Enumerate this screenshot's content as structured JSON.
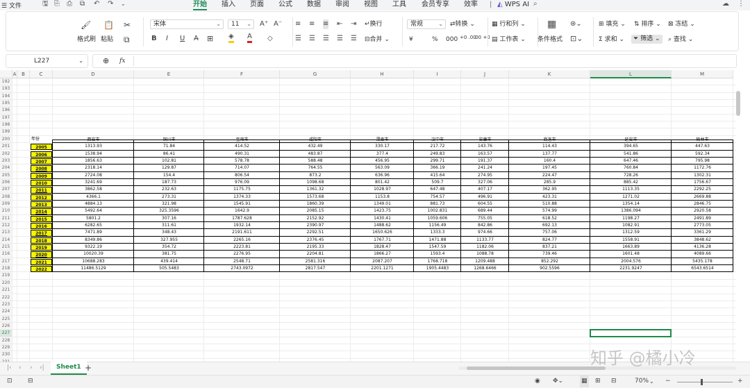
{
  "menubar": {
    "file": "文件",
    "tabs": [
      "开始",
      "插入",
      "页面",
      "公式",
      "数据",
      "审阅",
      "视图",
      "工具",
      "会员专享",
      "效率"
    ],
    "ai": "WPS AI"
  },
  "ribbon": {
    "format_painter": "格式刷",
    "paste": "粘贴",
    "font_name": "宋体",
    "font_size": "11",
    "wrap_text": "换行",
    "merge": "合并",
    "number_format": "常规",
    "convert": "转换",
    "currency": "¥",
    "percent": "%",
    "thousands": "000",
    "inc_decimal": "+0 .00",
    "dec_decimal": ".00 +0",
    "rows_cols": "行和列",
    "worksheet": "工作表",
    "cond_format": "条件格式",
    "fill": "填充",
    "sort": "排序",
    "freeze": "冻结",
    "sum": "求和",
    "filter": "筛选",
    "find": "查找"
  },
  "formula": {
    "cell_ref": "L227",
    "fx": "fx",
    "content": ""
  },
  "columns": [
    "A",
    "B",
    "C",
    "D",
    "E",
    "F",
    "G",
    "H",
    "I",
    "J",
    "K",
    "L",
    "M"
  ],
  "selected_column": "L",
  "visible_rows": {
    "first": 192,
    "last": 231
  },
  "selected_row": 227,
  "table": {
    "header_row": 200,
    "year_header": "年份",
    "cities": [
      "西安市",
      "铜川市",
      "宝鸡市",
      "咸阳市",
      "渭南市",
      "汉中市",
      "安康市",
      "商洛市",
      "延安市",
      "榆林市"
    ],
    "rows": [
      {
        "year": "2005",
        "values": [
          "1313.93",
          "71.84",
          "414.52",
          "432.49",
          "330.17",
          "217.72",
          "143.76",
          "114.43",
          "394.65",
          "447.63"
        ]
      },
      {
        "year": "2006",
        "values": [
          "1538.94",
          "86.41",
          "490.31",
          "483.87",
          "377.4",
          "249.83",
          "163.57",
          "137.77",
          "541.86",
          "592.34"
        ]
      },
      {
        "year": "2007",
        "values": [
          "1856.63",
          "102.81",
          "578.78",
          "588.48",
          "456.95",
          "299.71",
          "191.37",
          "160.4",
          "647.46",
          "795.98"
        ]
      },
      {
        "year": "2008",
        "values": [
          "2318.14",
          "129.87",
          "714.07",
          "764.55",
          "563.09",
          "366.19",
          "241.24",
          "197.45",
          "760.84",
          "1172.76"
        ]
      },
      {
        "year": "2009",
        "values": [
          "2724.08",
          "154.4",
          "806.54",
          "873.2",
          "636.96",
          "415.64",
          "274.95",
          "224.47",
          "728.26",
          "1302.31"
        ]
      },
      {
        "year": "2010",
        "values": [
          "3241.69",
          "187.73",
          "976.09",
          "1098.68",
          "801.42",
          "509.7",
          "327.06",
          "285.9",
          "885.42",
          "1756.67"
        ]
      },
      {
        "year": "2011",
        "values": [
          "3862.58",
          "232.63",
          "1175.75",
          "1361.32",
          "1028.97",
          "647.48",
          "407.17",
          "362.95",
          "1113.35",
          "2292.25"
        ]
      },
      {
        "year": "2012",
        "values": [
          "4366.1",
          "273.31",
          "1374.33",
          "1573.68",
          "1153.8",
          "754.57",
          "496.91",
          "423.31",
          "1271.02",
          "2669.88"
        ]
      },
      {
        "year": "2013",
        "values": [
          "4884.13",
          "321.98",
          "1545.91",
          "1860.39",
          "1349.01",
          "881.73",
          "604.55",
          "510.88",
          "1354.14",
          "2846.75"
        ]
      },
      {
        "year": "2014",
        "values": [
          "5492.64",
          "325.3596",
          "1642.9",
          "2085.15",
          "1423.75",
          "1002.831",
          "689.44",
          "574.99",
          "1386.094",
          "2920.58"
        ]
      },
      {
        "year": "2015",
        "values": [
          "5801.2",
          "307.16",
          "1787.628",
          "2152.92",
          "1430.41",
          "1059.606",
          "755.05",
          "618.52",
          "1198.27",
          "2491.89"
        ]
      },
      {
        "year": "2016",
        "values": [
          "6282.65",
          "311.61",
          "1932.14",
          "2390.97",
          "1488.62",
          "1156.49",
          "842.86",
          "692.13",
          "1082.91",
          "2773.05"
        ]
      },
      {
        "year": "2017",
        "values": [
          "7471.89",
          "348.43",
          "2191.611",
          "2292.51",
          "1650.626",
          "1333.3",
          "974.66",
          "757.06",
          "1312.59",
          "3361.29"
        ]
      },
      {
        "year": "2018",
        "values": [
          "8349.86",
          "327.955",
          "2265.16",
          "2376.45",
          "1767.71",
          "1471.88",
          "1133.77",
          "824.77",
          "1558.91",
          "3848.62"
        ]
      },
      {
        "year": "2019",
        "values": [
          "9322.19",
          "354.72",
          "2223.81",
          "2195.33",
          "1828.47",
          "1547.59",
          "1182.06",
          "837.21",
          "1663.89",
          "4136.28"
        ]
      },
      {
        "year": "2020",
        "values": [
          "10020.39",
          "381.75",
          "2276.95",
          "2204.81",
          "1866.27",
          "1593.4",
          "1088.78",
          "739.46",
          "1601.48",
          "4089.66"
        ]
      },
      {
        "year": "2021",
        "values": [
          "10688.283",
          "439.414",
          "2548.71",
          "2581.316",
          "2087.207",
          "1768.718",
          "1209.488",
          "852.292",
          "2004.576",
          "5435.178"
        ]
      },
      {
        "year": "2022",
        "values": [
          "11486.5129",
          "505.5483",
          "2743.0972",
          "2817.547",
          "2201.1271",
          "1905.4483",
          "1268.6466",
          "902.5596",
          "2231.9247",
          "6543.6514"
        ]
      }
    ]
  },
  "colors": {
    "accent": "#1e8a4a",
    "year_fill": "#f5f501"
  },
  "sheet": {
    "active": "Sheet1"
  },
  "watermark": "知乎 @橘小冷",
  "status": {
    "zoom": "70%"
  }
}
